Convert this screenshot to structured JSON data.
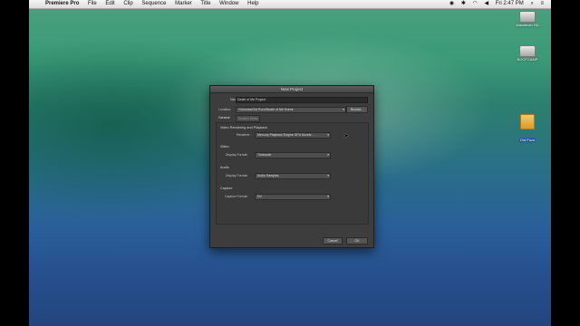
{
  "menubar": {
    "app_name": "Premiere Pro",
    "items": [
      "File",
      "Edit",
      "Clip",
      "Sequence",
      "Marker",
      "Title",
      "Window",
      "Help"
    ],
    "clock": "Fri 2:47 PM"
  },
  "desktop_icons": [
    {
      "label": "Macintosh HD"
    },
    {
      "label": "BOOTCAMP"
    },
    {
      "label": "Old Puzo"
    }
  ],
  "dialog": {
    "title": "New Project",
    "name_label": "Name:",
    "name_value": "Death of Me Project",
    "location_label": "Location:",
    "location_value": "/Volumes/Old Puzo/Death of Me Scene",
    "browse_label": "Browse...",
    "tabs": [
      "General",
      "Scratch Disks"
    ],
    "video_rendering": {
      "heading": "Video Rendering and Playback",
      "renderer_label": "Renderer:",
      "renderer_value": "Mercury Playback Engine GPU Accele..."
    },
    "video": {
      "heading": "Video",
      "display_format_label": "Display Format:",
      "display_format_value": "Timecode"
    },
    "audio": {
      "heading": "Audio",
      "display_format_label": "Display Format:",
      "display_format_value": "Audio Samples"
    },
    "capture": {
      "heading": "Capture",
      "capture_format_label": "Capture Format:",
      "capture_format_value": "DV"
    },
    "cancel_label": "Cancel",
    "ok_label": "OK"
  }
}
